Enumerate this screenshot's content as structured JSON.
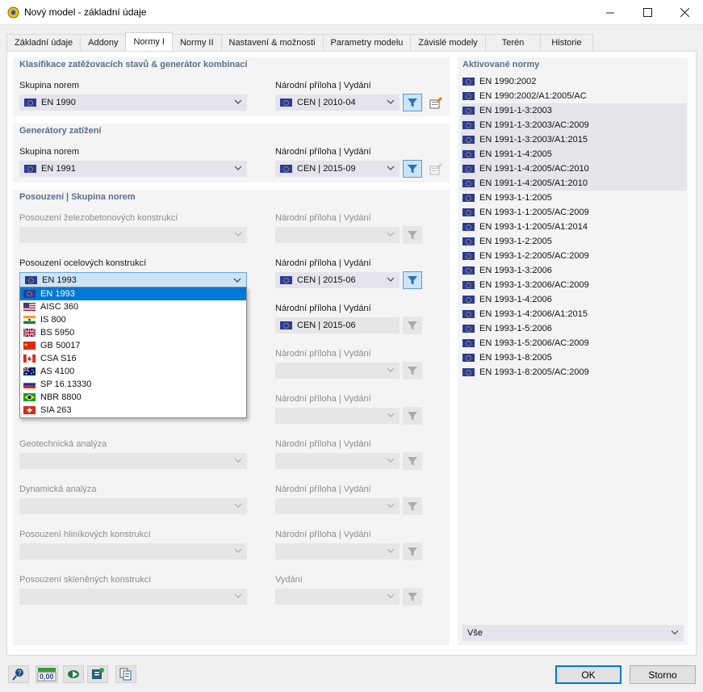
{
  "window": {
    "title": "Nový model - základní údaje",
    "minimize_glyph": "—",
    "maximize_glyph": "☐",
    "close_glyph": "✕"
  },
  "tabs": [
    {
      "label": "Základní údaje"
    },
    {
      "label": "Addony"
    },
    {
      "label": "Normy I"
    },
    {
      "label": "Normy II"
    },
    {
      "label": "Nastavení & možnosti"
    },
    {
      "label": "Parametry modelu"
    },
    {
      "label": "Závislé modely"
    },
    {
      "label": "Terén"
    },
    {
      "label": "Historie"
    }
  ],
  "active_tab": "Normy I",
  "classification": {
    "title": "Klasifikace zatěžovacích stavů & generátor kombinací",
    "group_label": "Skupina norem",
    "group_value": "EN 1990",
    "annex_label": "Národní příloha | Vydání",
    "annex_value": "CEN | 2010-04"
  },
  "generators": {
    "title": "Generátory zatížení",
    "group_label": "Skupina norem",
    "group_value": "EN 1991",
    "annex_label": "Národní příloha | Vydání",
    "annex_value": "CEN | 2015-09"
  },
  "design": {
    "title": "Posouzení | Skupina norem",
    "rows": [
      {
        "label": "Posouzení železobetonových konstrukcí",
        "annex_label": "Národní příloha | Vydání",
        "value": "",
        "annex_value": "",
        "enabled": false
      },
      {
        "label": "Posouzení ocelových konstrukcí",
        "annex_label": "Národní příloha | Vydání",
        "value": "EN 1993",
        "annex_value": "CEN | 2015-06",
        "enabled": true
      },
      {
        "label": "",
        "annex_label": "Národní příloha | Vydání",
        "value": "",
        "annex_value": "CEN | 2015-06",
        "enabled": false
      },
      {
        "label": "",
        "annex_label": "Národní příloha | Vydání",
        "value": "",
        "annex_value": "",
        "enabled": false
      },
      {
        "label": "",
        "annex_label": "Národní příloha | Vydání",
        "value": "",
        "annex_value": "",
        "enabled": false
      },
      {
        "label": "Geotechnická analýza",
        "annex_label": "Národní příloha | Vydání",
        "value": "",
        "annex_value": "",
        "enabled": false
      },
      {
        "label": "Dynamická analýza",
        "annex_label": "Národní příloha | Vydání",
        "value": "",
        "annex_value": "",
        "enabled": false
      },
      {
        "label": "Posouzení hliníkových konstrukcí",
        "annex_label": "Národní příloha | Vydání",
        "value": "",
        "annex_value": "",
        "enabled": false
      },
      {
        "label": "Posouzení skleněných konstrukcí",
        "annex_label": "Vydání",
        "value": "",
        "annex_value": "",
        "enabled": false
      }
    ]
  },
  "dropdown": {
    "options": [
      {
        "label": "EN 1993",
        "flag": "eu",
        "selected": true
      },
      {
        "label": "AISC 360",
        "flag": "us",
        "selected": false
      },
      {
        "label": "IS 800",
        "flag": "in",
        "selected": false
      },
      {
        "label": "BS 5950",
        "flag": "gb",
        "selected": false
      },
      {
        "label": "GB 50017",
        "flag": "cn",
        "selected": false
      },
      {
        "label": "CSA S16",
        "flag": "ca",
        "selected": false
      },
      {
        "label": "AS 4100",
        "flag": "au",
        "selected": false
      },
      {
        "label": "SP 16.13330",
        "flag": "ru",
        "selected": false
      },
      {
        "label": "NBR 8800",
        "flag": "br",
        "selected": false
      },
      {
        "label": "SIA 263",
        "flag": "ch",
        "selected": false
      }
    ]
  },
  "activated": {
    "title": "Aktivované normy",
    "items": [
      {
        "label": "EN 1990:2002",
        "highlight": false
      },
      {
        "label": "EN 1990:2002/A1:2005/AC",
        "highlight": false
      },
      {
        "label": "EN 1991-1-3:2003",
        "highlight": true
      },
      {
        "label": "EN 1991-1-3:2003/AC:2009",
        "highlight": true
      },
      {
        "label": "EN 1991-1-3:2003/A1:2015",
        "highlight": true
      },
      {
        "label": "EN 1991-1-4:2005",
        "highlight": true
      },
      {
        "label": "EN 1991-1-4:2005/AC:2010",
        "highlight": true
      },
      {
        "label": "EN 1991-1-4:2005/A1:2010",
        "highlight": true
      },
      {
        "label": "EN 1993-1-1:2005",
        "highlight": false
      },
      {
        "label": "EN 1993-1-1:2005/AC:2009",
        "highlight": false
      },
      {
        "label": "EN 1993-1-1:2005/A1:2014",
        "highlight": false
      },
      {
        "label": "EN 1993-1-2:2005",
        "highlight": false
      },
      {
        "label": "EN 1993-1-2:2005/AC:2009",
        "highlight": false
      },
      {
        "label": "EN 1993-1-3:2006",
        "highlight": false
      },
      {
        "label": "EN 1993-1-3:2006/AC:2009",
        "highlight": false
      },
      {
        "label": "EN 1993-1-4:2006",
        "highlight": false
      },
      {
        "label": "EN 1993-1-4:2006/A1:2015",
        "highlight": false
      },
      {
        "label": "EN 1993-1-5:2006",
        "highlight": false
      },
      {
        "label": "EN 1993-1-5:2006/AC:2009",
        "highlight": false
      },
      {
        "label": "EN 1993-1-8:2005",
        "highlight": false
      },
      {
        "label": "EN 1993-1-8:2005/AC:2009",
        "highlight": false
      }
    ],
    "filter_value": "Vše"
  },
  "footer": {
    "ok_label": "OK",
    "cancel_label": "Storno",
    "units_icon_text": "0,00"
  },
  "colors": {
    "accent": "#0078d7",
    "section_title": "#5a6e8c",
    "eu_flag": "#2a3a9a"
  }
}
